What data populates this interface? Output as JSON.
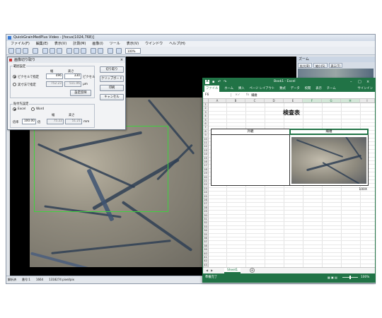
{
  "app": {
    "title": "QuickGrainMedPlus Video - [focus(1024,768)]",
    "menu": [
      "ファイル(F)",
      "編集(E)",
      "表示(V)",
      "計測(M)",
      "画像(I)",
      "ツール",
      "表示(V)",
      "ウインドウ",
      "ヘルプ(H)"
    ],
    "zoom_value": "100%",
    "status": [
      "解析済",
      "番号:1",
      "1664",
      "1318274 pixel/pix"
    ]
  },
  "zoom_pane": {
    "title": "ズーム",
    "tabs": [
      "拡大(B)",
      "縮小(S)",
      "表示(T)"
    ]
  },
  "dialog": {
    "title": "画像切り取り",
    "range_group": "範囲設定",
    "col_width": "幅",
    "col_height": "高さ",
    "radio_pixel": "ピクセルで指定",
    "radio_real": "実寸法で指定",
    "pixel_w": "496",
    "pixel_h": "330",
    "unit_pixel": "ピクセル",
    "real_w": "752.23",
    "real_h": "511.06",
    "unit_um": "μm",
    "calc_button": "設定反映",
    "btn_trim": "切り取り",
    "btn_clipboard": "クリップボード",
    "btn_print": "印刷",
    "btn_cancel": "キャンセル",
    "output_group": "貼付先設定",
    "radio_excel": "Excel",
    "radio_word": "Word",
    "col_w2": "幅",
    "col_h2": "高さ",
    "ratio_label": "倍率",
    "ratio_value": "100.00",
    "ratio_unit": "倍",
    "out_w": "75.22",
    "out_h": "51.21",
    "out_unit": "mm"
  },
  "excel": {
    "title": "Book1 - Excel",
    "signin": "サインイン",
    "ribbon_tabs": [
      "ファイル",
      "ホーム",
      "挿入",
      "ページ レイアウト",
      "数式",
      "データ",
      "校閲",
      "表示",
      "チーム"
    ],
    "name_box": "F6",
    "formula_value": "繊維",
    "columns": [
      "A",
      "B",
      "C",
      "D",
      "E",
      "F",
      "G",
      "H",
      "I"
    ],
    "sheet_title": "検査表",
    "header_left": "外観",
    "header_right": "繊維",
    "magnification": "100X",
    "sheet_tab": "Sheet1",
    "status_left": "準備完了",
    "zoom": "100%"
  }
}
